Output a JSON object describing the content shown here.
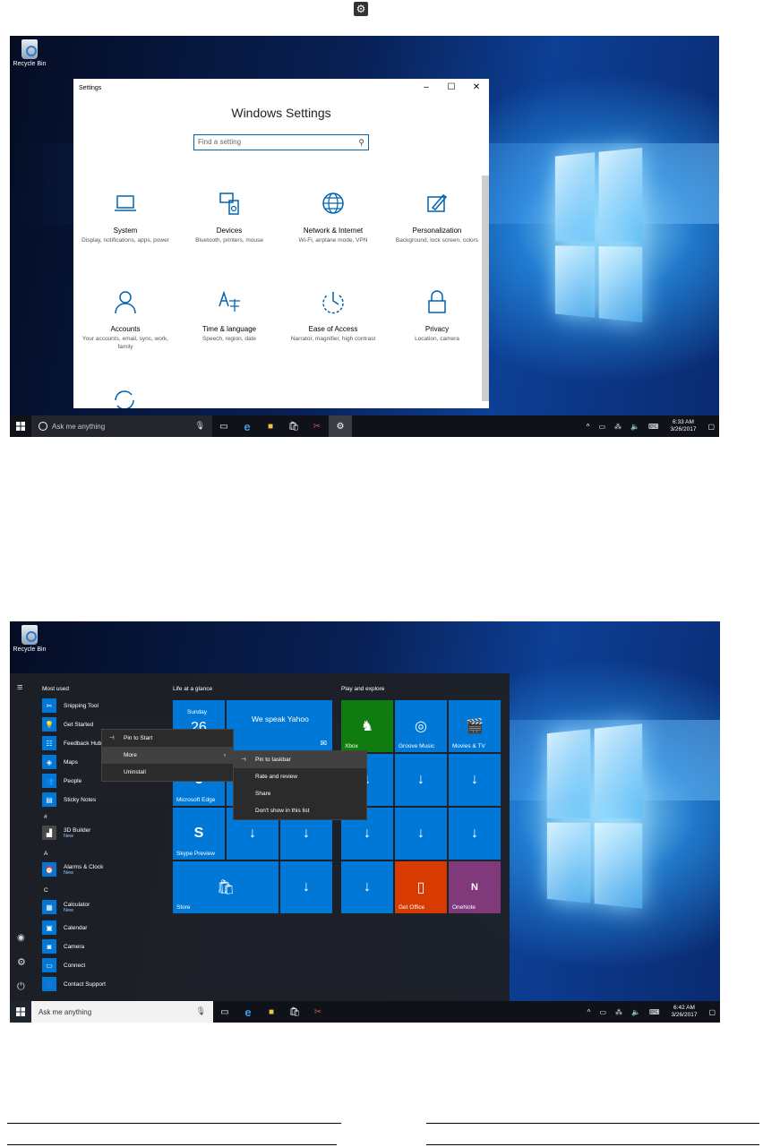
{
  "top_icon": "gear-icon",
  "shot1": {
    "desktop": {
      "recycle_bin_label": "Recycle Bin"
    },
    "settings_window": {
      "window_title": "Settings",
      "heading": "Windows Settings",
      "search_placeholder": "Find a setting",
      "categories": [
        {
          "name": "System",
          "desc": "Display, notifications, apps, power",
          "icon": "laptop-icon"
        },
        {
          "name": "Devices",
          "desc": "Bluetooth, printers, mouse",
          "icon": "devices-icon"
        },
        {
          "name": "Network & Internet",
          "desc": "Wi-Fi, airplane mode, VPN",
          "icon": "globe-icon"
        },
        {
          "name": "Personalization",
          "desc": "Background, lock screen, colors",
          "icon": "brush-icon"
        },
        {
          "name": "Accounts",
          "desc": "Your accounts, email, sync, work, family",
          "icon": "person-icon"
        },
        {
          "name": "Time & language",
          "desc": "Speech, region, date",
          "icon": "time-language-icon"
        },
        {
          "name": "Ease of Access",
          "desc": "Narrator, magnifier, high contrast",
          "icon": "ease-of-access-icon"
        },
        {
          "name": "Privacy",
          "desc": "Location, camera",
          "icon": "lock-icon"
        }
      ]
    },
    "taskbar": {
      "search_text": "Ask me anything",
      "time": "6:33 AM",
      "date": "3/26/2017"
    }
  },
  "shot2": {
    "desktop": {
      "recycle_bin_label": "Recycle Bin"
    },
    "start_menu": {
      "most_used_label": "Most used",
      "most_used": [
        {
          "label": "Snipping Tool",
          "color": "#0078d7"
        },
        {
          "label": "Get Started",
          "color": "#0078d7"
        },
        {
          "label": "Feedback Hub",
          "color": "#0078d7"
        },
        {
          "label": "Maps",
          "color": "#0078d7"
        },
        {
          "label": "People",
          "color": "#0078d7"
        },
        {
          "label": "Sticky Notes",
          "color": "#0078d7"
        }
      ],
      "sections": [
        {
          "letter": "#",
          "items": [
            {
              "label": "3D Builder",
              "sub": "New",
              "color": "#4a4a4a"
            }
          ]
        },
        {
          "letter": "A",
          "items": [
            {
              "label": "Alarms & Clock",
              "sub": "New",
              "color": "#0078d7"
            }
          ]
        },
        {
          "letter": "C",
          "items": [
            {
              "label": "Calculator",
              "sub": "New",
              "color": "#0078d7"
            },
            {
              "label": "Calendar",
              "sub": "",
              "color": "#0078d7"
            },
            {
              "label": "Camera",
              "sub": "",
              "color": "#0078d7"
            },
            {
              "label": "Connect",
              "sub": "",
              "color": "#0078d7"
            },
            {
              "label": "Contact Support",
              "sub": "",
              "color": "#0078d7"
            }
          ]
        }
      ],
      "group_life": "Life at a glance",
      "group_play": "Play and explore",
      "tiles": {
        "calendar_day": "Sunday",
        "calendar_num": "26",
        "mail_text": "We speak Yahoo",
        "edge_label": "Microsoft Edge",
        "skype_label": "Skype Preview",
        "store_label": "Store",
        "xbox_label": "Xbox",
        "groove_label": "Groove Music",
        "movies_label": "Movies & TV",
        "office_label": "Get Office",
        "onenote_label": "OneNote",
        "office_color": "#d83b01",
        "onenote_color": "#80397b"
      },
      "context_menu": {
        "pin_to_start": "Pin to Start",
        "more": "More",
        "uninstall": "Uninstall"
      },
      "submenu": {
        "pin_to_taskbar": "Pin to taskbar",
        "rate_review": "Rate and review",
        "share": "Share",
        "dont_show": "Don't show in this list"
      }
    },
    "taskbar": {
      "search_text": "Ask me anything",
      "time": "6:42 AM",
      "date": "3/26/2017"
    }
  }
}
